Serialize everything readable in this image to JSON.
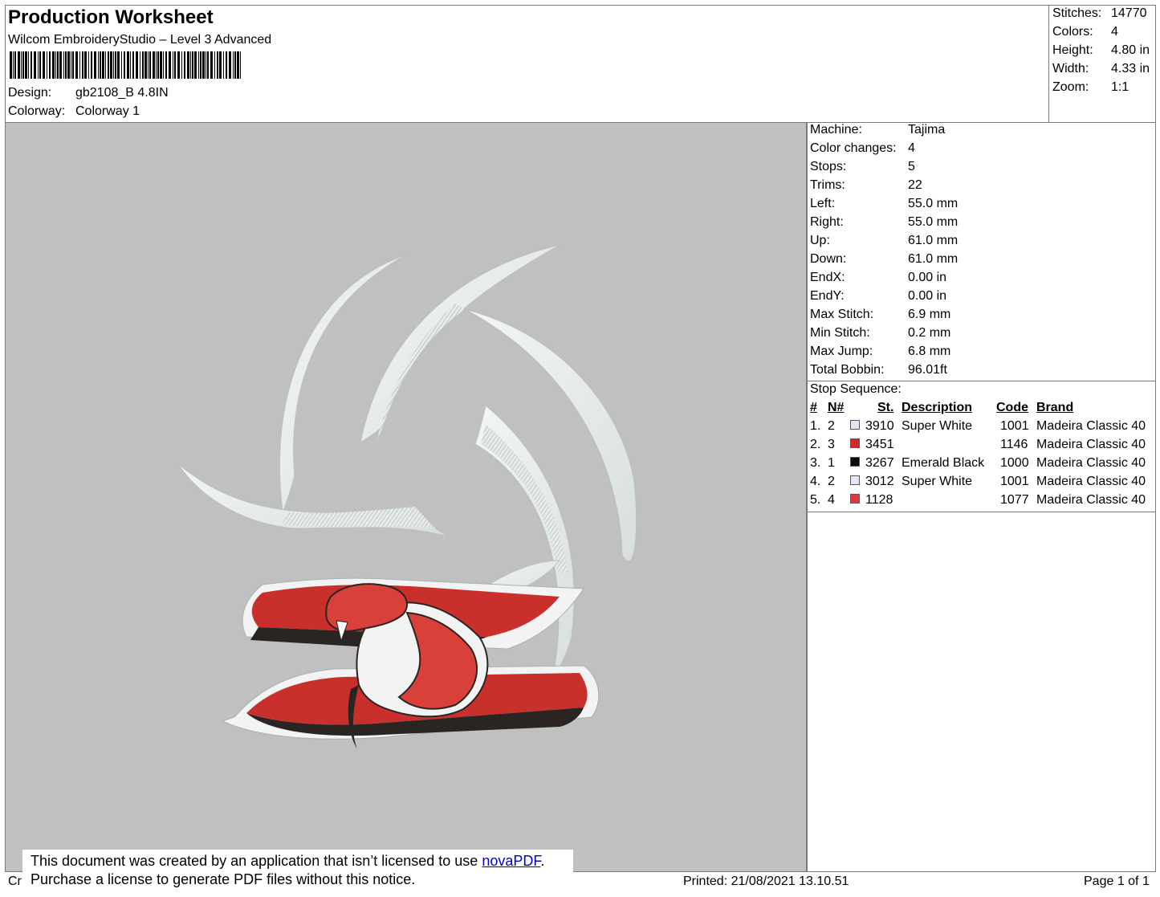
{
  "header": {
    "title": "Production Worksheet",
    "software": "Wilcom EmbroideryStudio – Level 3 Advanced",
    "design_label": "Design:",
    "design_value": "gb2108_B 4.8IN",
    "colorway_label": "Colorway:",
    "colorway_value": "Colorway 1"
  },
  "stats": [
    {
      "label": "Stitches:",
      "value": "14770"
    },
    {
      "label": "Colors:",
      "value": "4"
    },
    {
      "label": "Height:",
      "value": "4.80 in"
    },
    {
      "label": "Width:",
      "value": "4.33 in"
    },
    {
      "label": "Zoom:",
      "value": "1:1"
    }
  ],
  "machine_info": [
    {
      "label": "Machine:",
      "value": "Tajima"
    },
    {
      "label": "Color changes:",
      "value": "4"
    },
    {
      "label": "Stops:",
      "value": "5"
    },
    {
      "label": "Trims:",
      "value": "22"
    },
    {
      "label": "Left:",
      "value": "55.0 mm"
    },
    {
      "label": "Right:",
      "value": "55.0 mm"
    },
    {
      "label": "Up:",
      "value": "61.0 mm"
    },
    {
      "label": "Down:",
      "value": "61.0 mm"
    },
    {
      "label": "EndX:",
      "value": "0.00 in"
    },
    {
      "label": "EndY:",
      "value": "0.00 in"
    },
    {
      "label": "Max Stitch:",
      "value": "6.9 mm"
    },
    {
      "label": "Min Stitch:",
      "value": "0.2 mm"
    },
    {
      "label": "Max Jump:",
      "value": "6.8 mm"
    },
    {
      "label": "Total Bobbin:",
      "value": "96.01ft"
    }
  ],
  "stop_sequence": {
    "title": "Stop Sequence:",
    "headers": {
      "num": "#",
      "needle": "N#",
      "stitches": "St.",
      "description": "Description",
      "code": "Code",
      "brand": "Brand"
    },
    "rows": [
      {
        "num": "1.",
        "needle": "2",
        "color": "#e4e6f4",
        "stitches": "3910",
        "description": "Super White",
        "code": "1001",
        "brand": "Madeira Classic 40"
      },
      {
        "num": "2.",
        "needle": "3",
        "color": "#d7262a",
        "stitches": "3451",
        "description": "",
        "code": "1146",
        "brand": "Madeira Classic 40"
      },
      {
        "num": "3.",
        "needle": "1",
        "color": "#0a0a0a",
        "stitches": "3267",
        "description": "Emerald Black",
        "code": "1000",
        "brand": "Madeira Classic 40"
      },
      {
        "num": "4.",
        "needle": "2",
        "color": "#e4e6f4",
        "stitches": "3012",
        "description": "Super White",
        "code": "1001",
        "brand": "Madeira Classic 40"
      },
      {
        "num": "5.",
        "needle": "4",
        "color": "#e0383c",
        "stitches": "1128",
        "description": "",
        "code": "1077",
        "brand": "Madeira Classic 40"
      }
    ]
  },
  "notice": {
    "line1_prefix": "This document was created by an application that isn’t licensed to use ",
    "link": "novaPDF",
    "line1_suffix": ".",
    "line2": "Purchase a license to generate PDF files without this notice."
  },
  "footer": {
    "left": "Cr",
    "printed": "Printed: 21/08/2021 13.10.51",
    "page": "Page 1 of 1"
  }
}
